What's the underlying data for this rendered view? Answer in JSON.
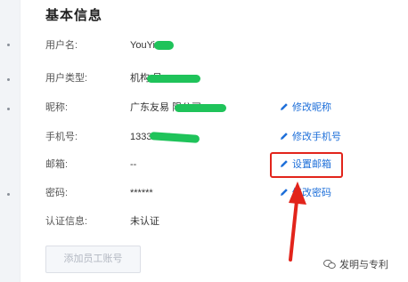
{
  "section": {
    "title": "基本信息"
  },
  "fields": [
    {
      "label": "用户名:",
      "value": "YouYi 1",
      "action": ""
    },
    {
      "label": "用户类型:",
      "value": "机构 员",
      "action": ""
    },
    {
      "label": "昵称:",
      "value": "广东友易 限公司",
      "action": "修改昵称"
    },
    {
      "label": "手机号:",
      "value": "1333 024",
      "action": "修改手机号"
    },
    {
      "label": "邮箱:",
      "value": "--",
      "action": "设置邮箱"
    },
    {
      "label": "密码:",
      "value": "******",
      "action": "修改密码"
    },
    {
      "label": "认证信息:",
      "value": "未认证",
      "action": ""
    }
  ],
  "add_button": {
    "label": "添加员工账号"
  },
  "watermark": {
    "text": "发明与专利"
  },
  "colors": {
    "link": "#1e6fd9",
    "annotation": "#e2241b",
    "redaction": "#1fc35a"
  },
  "icons": {
    "action_icon": "pencil-icon",
    "watermark_icon": "chat-bubble-icon"
  }
}
